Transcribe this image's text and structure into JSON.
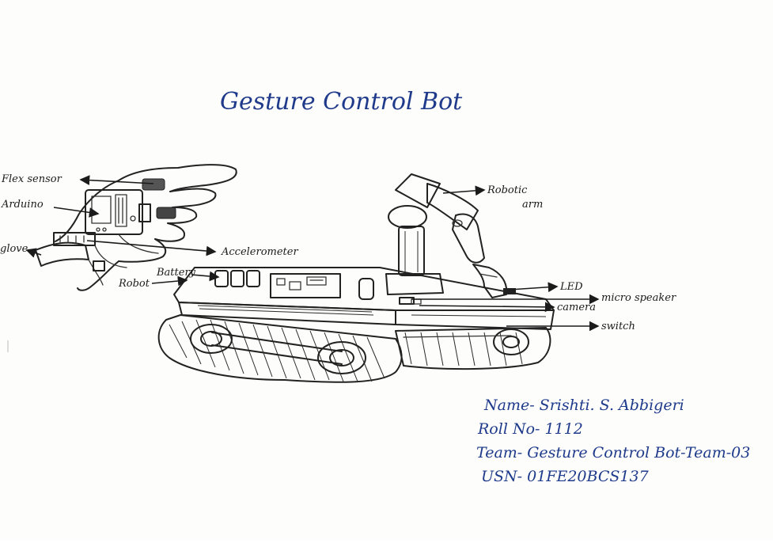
{
  "title": "Gesture Control Bot",
  "labels": {
    "flex_sensor": "Flex sensor",
    "arduino": "Arduino",
    "glove": "glove",
    "accelerometer": "Accelerometer",
    "battery": "Battery",
    "robot": "Robot",
    "robotic_arm_line1": "Robotic",
    "robotic_arm_line2": "arm",
    "led": "LED",
    "camera": "camera",
    "micro_speaker": "micro speaker",
    "switch": "switch"
  },
  "info": {
    "name": "Name- Srishti. S. Abbigeri",
    "roll": "Roll No- 1112",
    "team": "Team- Gesture Control Bot-Team-03",
    "usn": "USN- 01FE20BCS137"
  },
  "colors": {
    "ink_blue": "#1e3a8a",
    "pencil": "#222222",
    "paper": "#fdfdfc"
  }
}
